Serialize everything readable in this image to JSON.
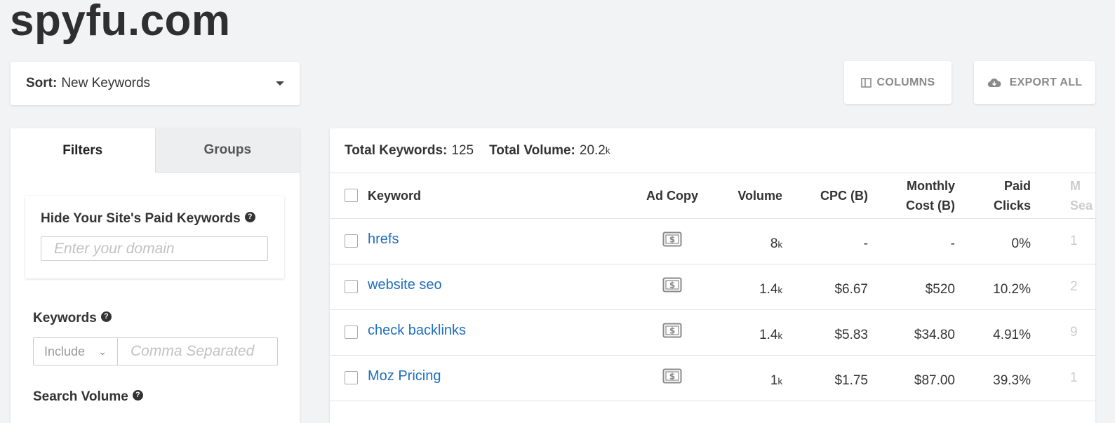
{
  "site": {
    "title": "spyfu.com"
  },
  "sort": {
    "label": "Sort:",
    "value": "New Keywords"
  },
  "toolbar": {
    "columns_label": "COLUMNS",
    "export_label": "EXPORT ALL"
  },
  "tabs": [
    {
      "label": "Filters",
      "active": true
    },
    {
      "label": "Groups",
      "active": false
    }
  ],
  "filters": {
    "hide_paid": {
      "title": "Hide Your Site's Paid Keywords",
      "placeholder": "Enter your domain"
    },
    "keywords": {
      "title": "Keywords",
      "mode": "Include",
      "placeholder": "Comma Separated"
    },
    "search_volume": {
      "title": "Search Volume"
    }
  },
  "totals": {
    "keywords_label": "Total Keywords:",
    "keywords_value": "125",
    "volume_label": "Total Volume:",
    "volume_value": "20.2",
    "volume_unit": "k"
  },
  "table": {
    "columns": {
      "keyword": "Keyword",
      "ad_copy": "Ad Copy",
      "volume": "Volume",
      "cpc": "CPC (B)",
      "monthly_cost_1": "Monthly",
      "monthly_cost_2": "Cost (B)",
      "paid_clicks_1": "Paid",
      "paid_clicks_2": "Clicks",
      "more_1": "M",
      "more_2": "Sea"
    },
    "rows": [
      {
        "keyword": "hrefs",
        "volume": "8",
        "volume_unit": "k",
        "cpc": "-",
        "monthly_cost": "-",
        "paid_clicks": "0%",
        "more": "1"
      },
      {
        "keyword": "website seo",
        "volume": "1.4",
        "volume_unit": "k",
        "cpc": "$6.67",
        "monthly_cost": "$520",
        "paid_clicks": "10.2%",
        "more": "2"
      },
      {
        "keyword": "check backlinks",
        "volume": "1.4",
        "volume_unit": "k",
        "cpc": "$5.83",
        "monthly_cost": "$34.80",
        "paid_clicks": "4.91%",
        "more": "9"
      },
      {
        "keyword": "Moz Pricing",
        "volume": "1",
        "volume_unit": "k",
        "cpc": "$1.75",
        "monthly_cost": "$87.00",
        "paid_clicks": "39.3%",
        "more": "1"
      }
    ]
  }
}
